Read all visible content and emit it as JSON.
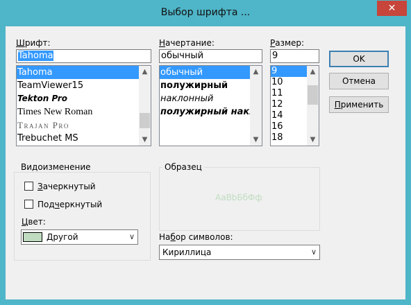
{
  "window": {
    "title": "Выбор шрифта ...",
    "close_glyph": "✕"
  },
  "font": {
    "label_underlined": "Ш",
    "label_rest": "рифт:",
    "value": "Tahoma",
    "items": [
      "Tahoma",
      "TeamViewer15",
      "Tekton Pro",
      "Times New Roman",
      "Trajan Pro",
      "Trebuchet MS"
    ],
    "selected_index": 0
  },
  "style": {
    "label_underlined": "Н",
    "label_rest": "ачертание:",
    "value": "обычный",
    "items": [
      "обычный",
      "полужирный",
      "наклонный",
      "полужирный наклонный"
    ],
    "selected_index": 0
  },
  "size": {
    "label_underlined": "Р",
    "label_rest": "азмер:",
    "value": "9",
    "items": [
      "9",
      "10",
      "11",
      "12",
      "14",
      "16",
      "18"
    ],
    "selected_index": 0
  },
  "buttons": {
    "ok": "OK",
    "cancel": "Отмена",
    "apply_underlined": "П",
    "apply_pre": "",
    "apply": "Применить"
  },
  "effects": {
    "group_title": "Видоизменение",
    "strikeout_u": "З",
    "strikeout_rest": "ачеркнутый",
    "underline_pre": "Под",
    "underline_u": "ч",
    "underline_rest": "еркнутый",
    "strikeout_checked": false,
    "underline_checked": false,
    "color_label_u": "Ц",
    "color_label_rest": "вет:",
    "color_value": "Другой",
    "color_swatch": "#c0dcc0"
  },
  "sample": {
    "group_title": "Образец",
    "text": "AaBbБбФф",
    "color": "#c0dcc0"
  },
  "charset": {
    "label_u": "б",
    "label_pre": "На",
    "label_rest": "ор символов:",
    "value": "Кириллица"
  },
  "colors": {
    "selection": "#3399ff",
    "titlebar": "#4fb5c8",
    "close": "#c7453a",
    "face": "#f0f0f0"
  }
}
